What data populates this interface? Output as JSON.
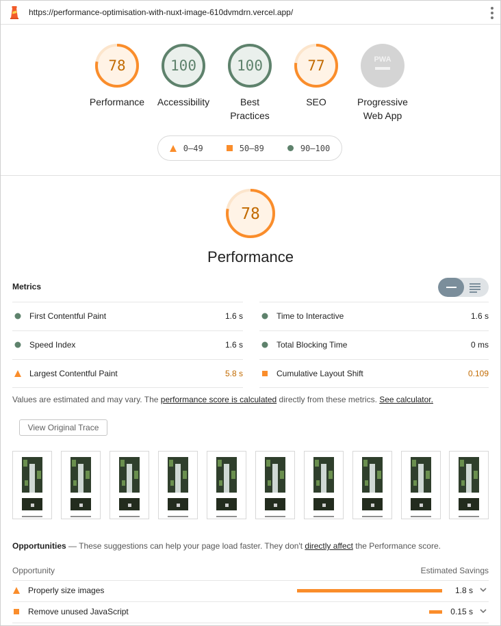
{
  "topbar": {
    "url": "https://performance-optimisation-with-nuxt-image-610dvmdrn.vercel.app/"
  },
  "colors": {
    "pass": "#5e826c",
    "average": "#fa8d2b",
    "pwa_gray": "#c8c8c8"
  },
  "summary": {
    "gauges": [
      {
        "score": "78",
        "value": 78,
        "label": "Performance",
        "rating": "average"
      },
      {
        "score": "100",
        "value": 100,
        "label": "Accessibility",
        "rating": "pass"
      },
      {
        "score": "100",
        "value": 100,
        "label": "Best Practices",
        "rating": "pass"
      },
      {
        "score": "77",
        "value": 77,
        "label": "SEO",
        "rating": "average"
      },
      {
        "score": "",
        "value": null,
        "label": "Progressive Web App",
        "badge": "PWA",
        "rating": "na"
      }
    ],
    "legend": [
      {
        "icon": "triangle-icon",
        "range": "0–49"
      },
      {
        "icon": "square-icon",
        "range": "50–89"
      },
      {
        "icon": "circle-icon",
        "range": "90–100"
      }
    ]
  },
  "performance": {
    "score": "78",
    "value": 78,
    "title": "Performance",
    "metrics_heading": "Metrics",
    "metrics": [
      {
        "name": "First Contentful Paint",
        "value": "1.6 s",
        "rating": "pass"
      },
      {
        "name": "Time to Interactive",
        "value": "1.6 s",
        "rating": "pass"
      },
      {
        "name": "Speed Index",
        "value": "1.6 s",
        "rating": "pass"
      },
      {
        "name": "Total Blocking Time",
        "value": "0 ms",
        "rating": "pass"
      },
      {
        "name": "Largest Contentful Paint",
        "value": "5.8 s",
        "rating": "fail"
      },
      {
        "name": "Cumulative Layout Shift",
        "value": "0.109",
        "rating": "average"
      }
    ],
    "note": {
      "prefix": "Values are estimated and may vary. The ",
      "link1": "performance score is calculated",
      "middle": " directly from these metrics. ",
      "link2": "See calculator."
    },
    "trace_button": "View Original Trace",
    "filmstrip_count": 10
  },
  "opportunities": {
    "title": "Opportunities",
    "dash": " — ",
    "desc_prefix": "These suggestions can help your page load faster. They don't ",
    "desc_link": "directly affect",
    "desc_suffix": " the Performance score.",
    "col_opportunity": "Opportunity",
    "col_savings": "Estimated Savings",
    "items": [
      {
        "name": "Properly size images",
        "savings": "1.8 s",
        "fraction": 1.0,
        "rating": "fail"
      },
      {
        "name": "Remove unused JavaScript",
        "savings": "0.15 s",
        "fraction": 0.09,
        "rating": "average"
      }
    ]
  }
}
